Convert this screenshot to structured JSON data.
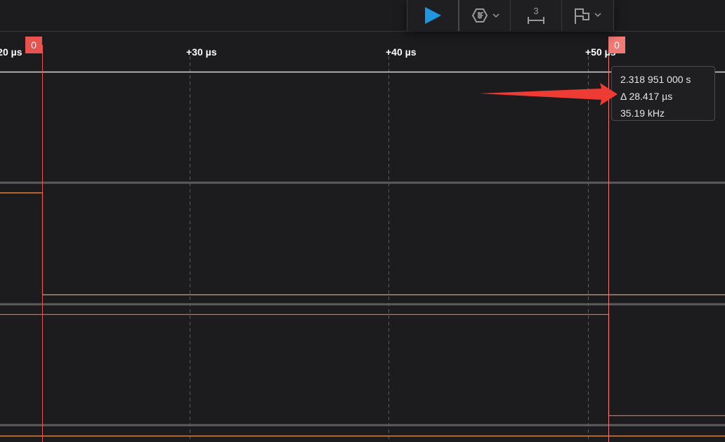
{
  "toolbar": {
    "play_icon": "play-icon",
    "trigger_icon": "trigger-icon",
    "measure_icon": "measure-icon",
    "measure_count": "3",
    "flag_icon": "flag-icon"
  },
  "timeline": {
    "ticks": [
      {
        "label": "+20 µs"
      },
      {
        "label": "+30 µs"
      },
      {
        "label": "+40 µs"
      },
      {
        "label": "+50 µs"
      }
    ],
    "markers": [
      {
        "label": "0"
      },
      {
        "label": "0"
      }
    ]
  },
  "tooltip": {
    "time": "2.318 951 000 s",
    "delta": "Δ 28.417 µs",
    "frequency": "35.19 kHz"
  },
  "colors": {
    "background": "#1c1c1e",
    "marker": "#e8524f",
    "channel_orange": "#e8945a",
    "channel_red": "#e8605a",
    "annotation_arrow": "#ee3b33",
    "play": "#1e96e0"
  }
}
